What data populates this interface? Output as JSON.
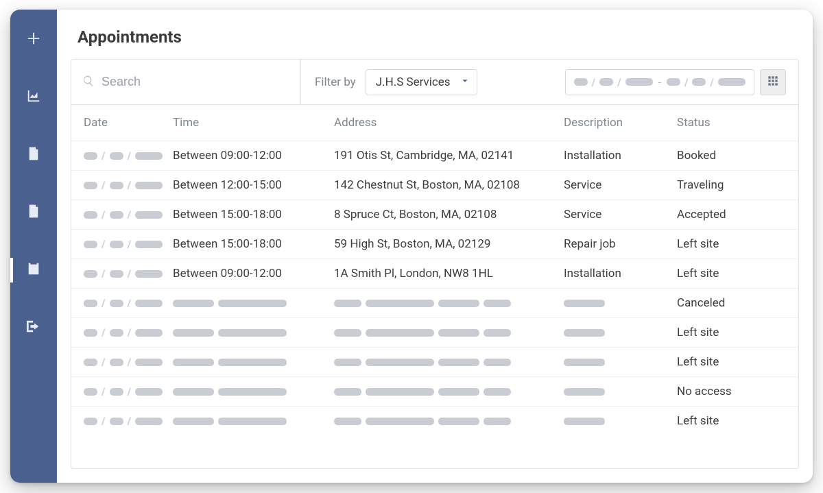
{
  "page": {
    "title": "Appointments"
  },
  "sidebar": {
    "items": [
      {
        "name": "add",
        "icon": "plus-icon",
        "active": false
      },
      {
        "name": "reports",
        "icon": "chart-icon",
        "active": false
      },
      {
        "name": "invoices",
        "icon": "invoice-icon",
        "active": false
      },
      {
        "name": "documents",
        "icon": "document-icon",
        "active": false
      },
      {
        "name": "calendar",
        "icon": "calendar-icon",
        "active": true
      },
      {
        "name": "logout",
        "icon": "logout-icon",
        "active": false
      }
    ]
  },
  "toolbar": {
    "search_placeholder": "Search",
    "filter_label": "Filter by",
    "filter_value": "J.H.S Services",
    "date_range_separator": "-"
  },
  "table": {
    "headers": {
      "date": "Date",
      "time": "Time",
      "address": "Address",
      "description": "Description",
      "status": "Status"
    },
    "rows": [
      {
        "date": null,
        "time": "Between 09:00-12:00",
        "address": "191 Otis St, Cambridge, MA, 02141",
        "description": "Installation",
        "status": "Booked"
      },
      {
        "date": null,
        "time": "Between 12:00-15:00",
        "address": "142 Chestnut St, Boston, MA, 02108",
        "description": "Service",
        "status": "Traveling"
      },
      {
        "date": null,
        "time": "Between 15:00-18:00",
        "address": "8 Spruce Ct, Boston, MA, 02108",
        "description": "Service",
        "status": "Accepted"
      },
      {
        "date": null,
        "time": "Between 15:00-18:00",
        "address": "59 High St, Boston, MA, 02129",
        "description": "Repair job",
        "status": "Left site"
      },
      {
        "date": null,
        "time": "Between 09:00-12:00",
        "address": "1A Smith Pl, London, NW8 1HL",
        "description": "Installation",
        "status": "Left site"
      },
      {
        "date": null,
        "time": null,
        "address": null,
        "description": null,
        "status": "Canceled"
      },
      {
        "date": null,
        "time": null,
        "address": null,
        "description": null,
        "status": "Left site"
      },
      {
        "date": null,
        "time": null,
        "address": null,
        "description": null,
        "status": "Left site"
      },
      {
        "date": null,
        "time": null,
        "address": null,
        "description": null,
        "status": "No access"
      },
      {
        "date": null,
        "time": null,
        "address": null,
        "description": null,
        "status": "Left site"
      }
    ]
  }
}
